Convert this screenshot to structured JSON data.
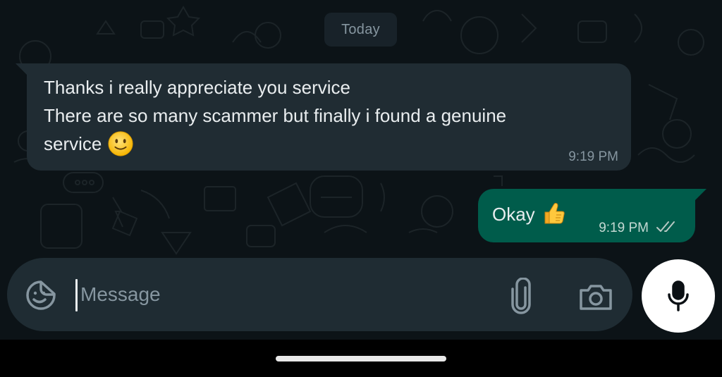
{
  "chat": {
    "date_separator": "Today",
    "messages": [
      {
        "direction": "incoming",
        "lines": [
          "Thanks i really appreciate you service",
          "There are so many scammer but finally i found a genuine",
          "service"
        ],
        "emoji": "slightly-smiling-face",
        "time": "9:19 PM"
      },
      {
        "direction": "outgoing",
        "text": "Okay",
        "emoji": "thumbs-up",
        "time": "9:19 PM",
        "status": "delivered-double-check"
      }
    ]
  },
  "composer": {
    "placeholder": "Message",
    "value": ""
  },
  "icons": {
    "sticker": "sticker-icon",
    "attach": "paperclip-icon",
    "camera": "camera-icon",
    "mic": "microphone-icon",
    "status": "double-check-icon"
  },
  "colors": {
    "background": "#0c1317",
    "incoming_bubble": "#202c33",
    "outgoing_bubble": "#005c4b",
    "composer": "#1f2c33",
    "mic_button": "#ffffff",
    "text": "#e9edef",
    "muted": "#8696a0"
  }
}
